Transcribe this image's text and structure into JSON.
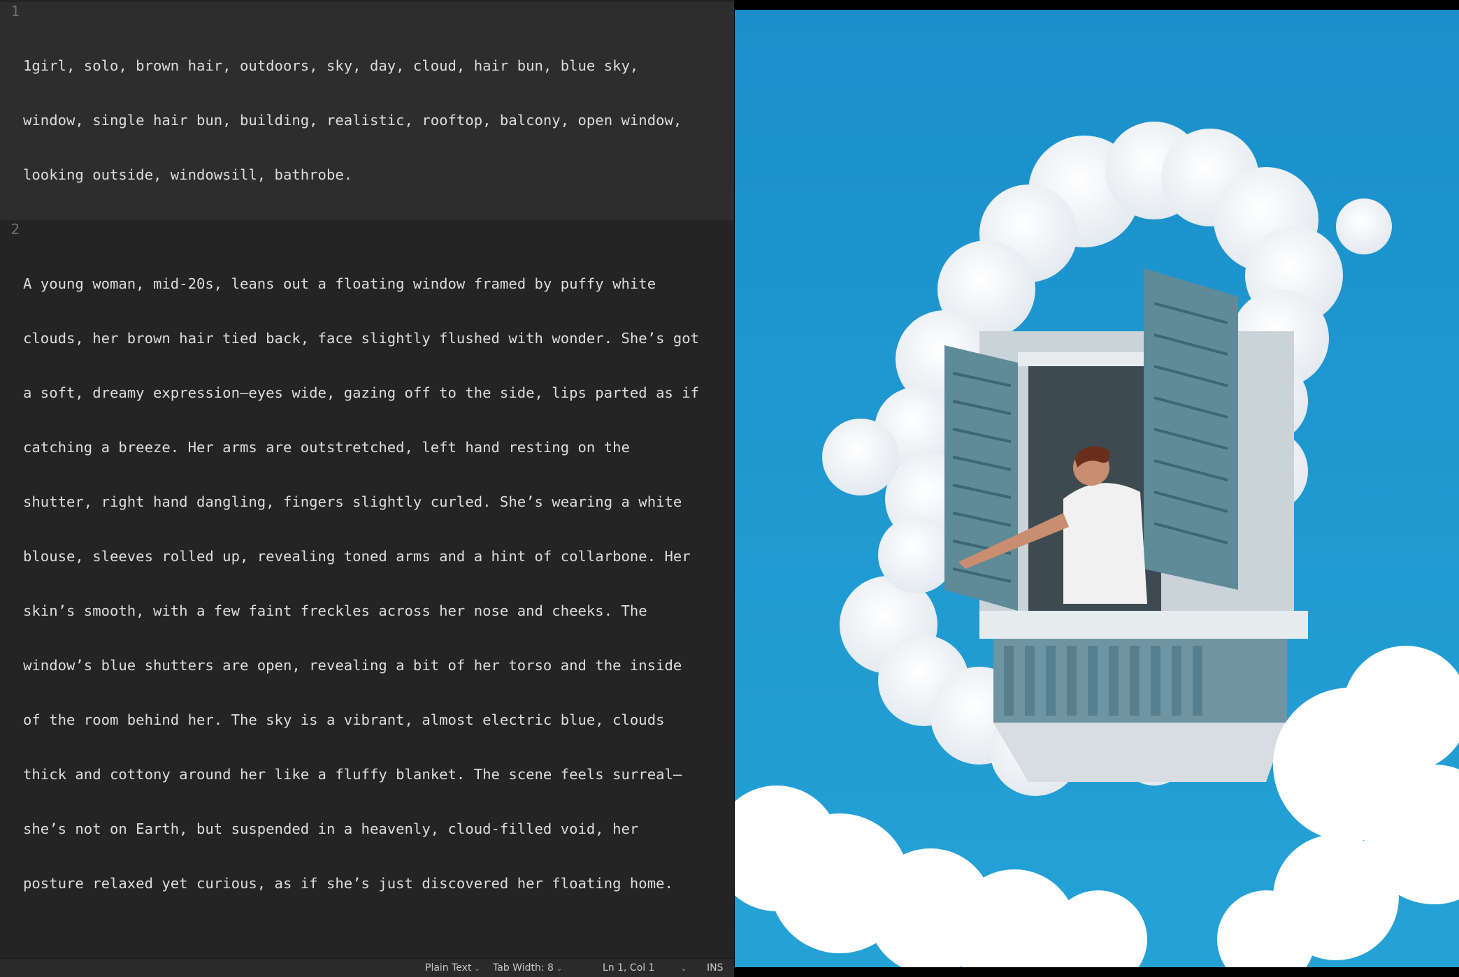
{
  "editor": {
    "lines": [
      {
        "number": "1",
        "rows": [
          "1girl, solo, brown hair, outdoors, sky, day, cloud, hair bun, blue sky,",
          "window, single hair bun, building, realistic, rooftop, balcony, open window,",
          "looking outside, windowsill, bathrobe."
        ]
      },
      {
        "number": "2",
        "rows": [
          "A young woman, mid-20s, leans out a floating window framed by puffy white",
          "clouds, her brown hair tied back, face slightly flushed with wonder. She’s got",
          "a soft, dreamy expression—eyes wide, gazing off to the side, lips parted as if",
          "catching a breeze. Her arms are outstretched, left hand resting on the",
          "shutter, right hand dangling, fingers slightly curled. She’s wearing a white",
          "blouse, sleeves rolled up, revealing toned arms and a hint of collarbone. Her",
          "skin’s smooth, with a few faint freckles across her nose and cheeks. The",
          "window’s blue shutters are open, revealing a bit of her torso and the inside",
          "of the room behind her. The sky is a vibrant, almost electric blue, clouds",
          "thick and cottony around her like a fluffy blanket. The scene feels surreal—",
          "she’s not on Earth, but suspended in a heavenly, cloud-filled void, her",
          "posture relaxed yet curious, as if she’s just discovered her floating home."
        ]
      }
    ]
  },
  "statusbar": {
    "language": "Plain Text",
    "tab_width": "Tab Width: 8",
    "cursor": "Ln 1, Col 1",
    "mode": "INS"
  },
  "image": {
    "sky_color": "#1f98cf",
    "shutter_color": "#5f8a98"
  }
}
